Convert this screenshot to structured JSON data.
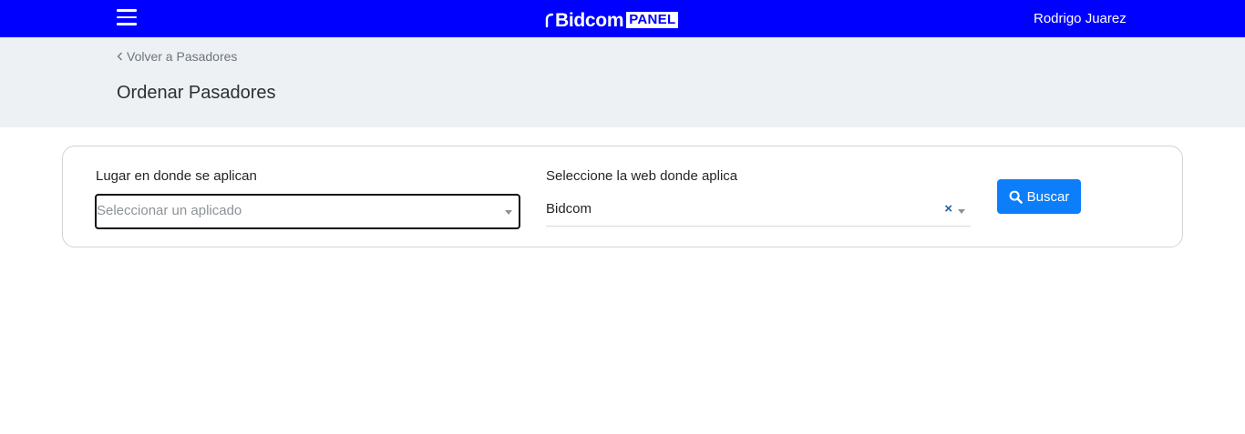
{
  "header": {
    "brand_name": "Bidcom",
    "brand_badge": "PANEL",
    "user_name": "Rodrigo Juarez",
    "colors": {
      "bar": "#0000ff",
      "text": "#ffffff"
    },
    "menu_icon": "hamburger-menu-icon"
  },
  "subheader": {
    "back_link": "Volver a Pasadores",
    "back_icon": "chevron-left-icon",
    "page_title": "Ordenar Pasadores"
  },
  "filters": {
    "lugar": {
      "label": "Lugar en donde se aplican",
      "placeholder": "Seleccionar un aplicado",
      "value": ""
    },
    "web": {
      "label": "Seleccione la web donde aplica",
      "value": "Bidcom",
      "clear_icon": "×"
    },
    "search_button": {
      "label": "Buscar",
      "icon": "search-icon",
      "color": "#0d7ef9"
    }
  }
}
